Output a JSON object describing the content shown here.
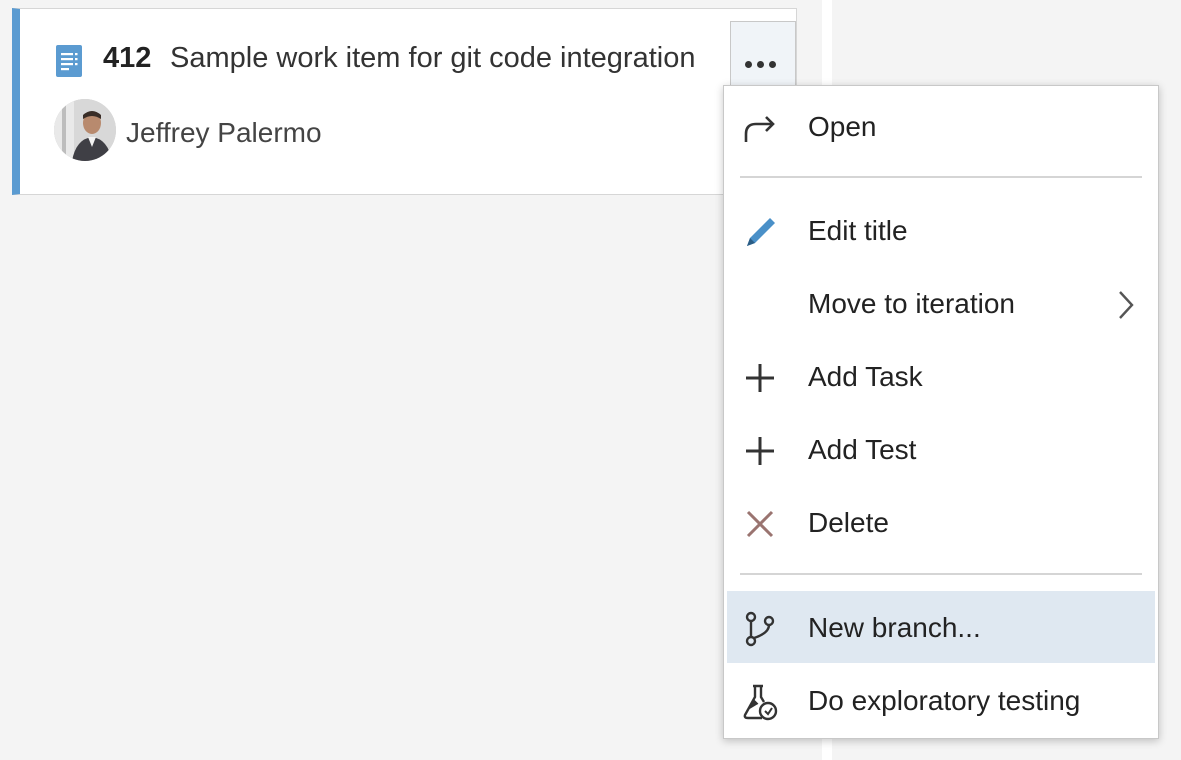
{
  "card": {
    "id": "412",
    "title": "Sample work item for git code integration",
    "assignee": "Jeffrey Palermo",
    "accent_color": "#5b9bd1",
    "type_icon": "backlog-item-icon",
    "more_icon": "more-options-icon"
  },
  "menu": {
    "items": [
      {
        "label": "Open",
        "icon": "open-arrow-icon"
      },
      {
        "label": "Edit title",
        "icon": "pencil-icon"
      },
      {
        "label": "Move to iteration",
        "icon": "",
        "submenu": true
      },
      {
        "label": "Add Task",
        "icon": "plus-icon"
      },
      {
        "label": "Add Test",
        "icon": "plus-icon"
      },
      {
        "label": "Delete",
        "icon": "delete-x-icon"
      },
      {
        "label": "New branch...",
        "icon": "git-branch-icon",
        "highlighted": true
      },
      {
        "label": "Do exploratory testing",
        "icon": "flask-icon"
      }
    ],
    "highlight_color": "#dfe8f1"
  }
}
